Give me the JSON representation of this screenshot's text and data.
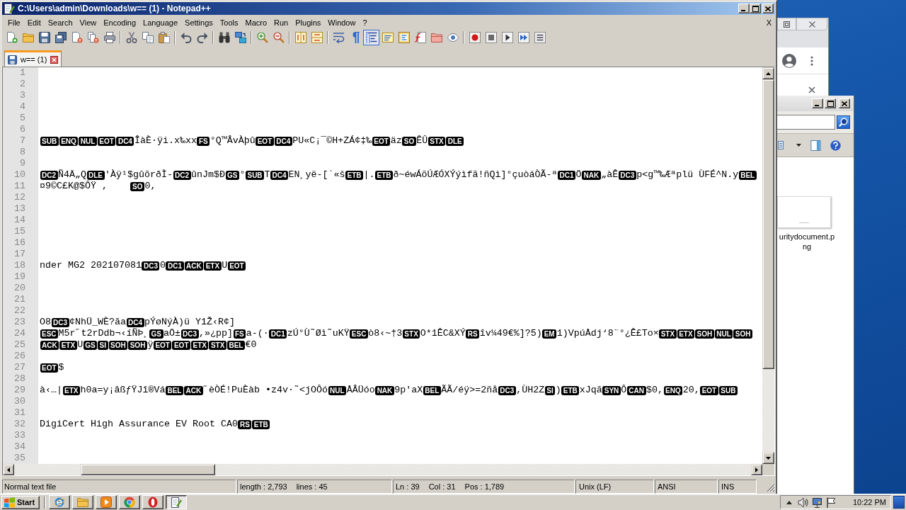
{
  "window": {
    "title": "C:\\Users\\admin\\Downloads\\w== (1) - Notepad++"
  },
  "menu": {
    "items": [
      "File",
      "Edit",
      "Search",
      "View",
      "Encoding",
      "Language",
      "Settings",
      "Tools",
      "Macro",
      "Run",
      "Plugins",
      "Window",
      "?"
    ],
    "close": "X"
  },
  "toolbar": [
    [
      {
        "pressed": false
      },
      {
        "pressed": false
      },
      {
        "pressed": false
      },
      {
        "pressed": false
      },
      {
        "pressed": false
      },
      {
        "pressed": false
      },
      {
        "pressed": false
      }
    ],
    [
      {
        "pressed": false
      },
      {
        "pressed": false
      },
      {
        "pressed": false
      }
    ],
    [
      {
        "pressed": false
      },
      {
        "pressed": false
      }
    ],
    [
      {
        "pressed": false
      },
      {
        "pressed": false
      }
    ],
    [
      {
        "pressed": false
      },
      {
        "pressed": false
      }
    ],
    [
      {
        "pressed": false
      },
      {
        "pressed": false
      }
    ],
    [
      {
        "pressed": false
      },
      {
        "pressed": false
      },
      {
        "pressed": true
      },
      {
        "pressed": false
      },
      {
        "pressed": false
      },
      {
        "pressed": false
      },
      {
        "pressed": false
      },
      {
        "pressed": false
      }
    ],
    [
      {
        "pressed": false
      },
      {
        "pressed": false
      },
      {
        "pressed": false
      },
      {
        "pressed": false
      },
      {
        "pressed": false
      }
    ]
  ],
  "tabs": [
    {
      "label": "w== (1)",
      "selected": true
    }
  ],
  "editor": {
    "lines": [
      {
        "number": "1"
      },
      {
        "number": "2"
      },
      {
        "number": "3"
      },
      {
        "number": "4"
      },
      {
        "number": "5"
      },
      {
        "number": "6"
      },
      {
        "number": "7",
        "segments": [
          {
            "kind": "ctrl",
            "text": "SUB"
          },
          {
            "kind": "ctrl",
            "text": "ENQ"
          },
          {
            "kind": "ctrl",
            "text": "NUL"
          },
          {
            "kind": "ctrl",
            "text": "EOT"
          },
          {
            "kind": "ctrl",
            "text": "DC4"
          },
          {
            "kind": "text",
            "text": "ÎàÈ·ÿi.x‰xx"
          },
          {
            "kind": "ctrl",
            "text": "FS"
          },
          {
            "kind": "text",
            "text": "°Q™ÂvÀþû"
          },
          {
            "kind": "ctrl",
            "text": "EOT"
          },
          {
            "kind": "ctrl",
            "text": "DC4"
          },
          {
            "kind": "text",
            "text": "PU«C¡¯©H+ZÁ¢‡‰"
          },
          {
            "kind": "ctrl",
            "text": "EOT"
          },
          {
            "kind": "text",
            "text": "äz"
          },
          {
            "kind": "ctrl",
            "text": "SO"
          },
          {
            "kind": "text",
            "text": "ÊÛ"
          },
          {
            "kind": "ctrl",
            "text": "STX"
          },
          {
            "kind": "ctrl",
            "text": "DLE"
          }
        ]
      },
      {
        "number": "8"
      },
      {
        "number": "9"
      },
      {
        "number": "10",
        "segments": [
          {
            "kind": "ctrl",
            "text": "DC2"
          },
          {
            "kind": "text",
            "text": "Ñ4Ä„Q"
          },
          {
            "kind": "ctrl",
            "text": "DLE"
          },
          {
            "kind": "text",
            "text": "'Àÿ¹$gûõrðÌ-"
          },
          {
            "kind": "ctrl",
            "text": "DC2"
          },
          {
            "kind": "text",
            "text": "ûnJm$Ð"
          },
          {
            "kind": "ctrl",
            "text": "GS"
          },
          {
            "kind": "text",
            "text": "°"
          },
          {
            "kind": "ctrl",
            "text": "SUB"
          },
          {
            "kind": "text",
            "text": "T"
          },
          {
            "kind": "ctrl",
            "text": "DC4"
          },
          {
            "kind": "text",
            "text": "EN¸yë-[`«š"
          },
          {
            "kind": "ctrl",
            "text": "ETB"
          },
          {
            "kind": "text",
            "text": "|."
          },
          {
            "kind": "ctrl",
            "text": "ETB"
          },
          {
            "kind": "text",
            "text": "ð~éwÁõÚÆÓXÝýìfã!ñQì]°çuòáÒÃ-ª"
          },
          {
            "kind": "ctrl",
            "text": "DC1"
          },
          {
            "kind": "text",
            "text": "Ö"
          },
          {
            "kind": "ctrl",
            "text": "NAK"
          },
          {
            "kind": "text",
            "text": "„àÊ"
          },
          {
            "kind": "ctrl",
            "text": "DC3"
          },
          {
            "kind": "text",
            "text": "p<g™‰Æªplü ÙFÉ^N.y"
          },
          {
            "kind": "ctrl",
            "text": "BEL"
          }
        ]
      },
      {
        "number": "11",
        "segments": [
          {
            "kind": "text",
            "text": "¤9©C£K@$ÔŸ ,    "
          },
          {
            "kind": "ctrl",
            "text": "SO"
          },
          {
            "kind": "text",
            "text": "0,"
          }
        ]
      },
      {
        "number": "12"
      },
      {
        "number": "13"
      },
      {
        "number": "14"
      },
      {
        "number": "15"
      },
      {
        "number": "16"
      },
      {
        "number": "17"
      },
      {
        "number": "18",
        "segments": [
          {
            "kind": "text",
            "text": "nder MG2 202107081"
          },
          {
            "kind": "ctrl",
            "text": "DC3"
          },
          {
            "kind": "text",
            "text": "0"
          },
          {
            "kind": "ctrl",
            "text": "DC1"
          },
          {
            "kind": "ctrl",
            "text": "ACK"
          },
          {
            "kind": "ctrl",
            "text": "ETX"
          },
          {
            "kind": "text",
            "text": "U"
          },
          {
            "kind": "ctrl",
            "text": "EOT"
          }
        ]
      },
      {
        "number": "19"
      },
      {
        "number": "20"
      },
      {
        "number": "21"
      },
      {
        "number": "22"
      },
      {
        "number": "23",
        "segments": [
          {
            "kind": "text",
            "text": "O8"
          },
          {
            "kind": "ctrl",
            "text": "DC3"
          },
          {
            "kind": "text",
            "text": "¢NhÜ_WÈ?ãa"
          },
          {
            "kind": "ctrl",
            "text": "DC4"
          },
          {
            "kind": "text",
            "text": "pÝøNýÀ)ü Y1Ž‹R¢]"
          }
        ]
      },
      {
        "number": "24",
        "segments": [
          {
            "kind": "ctrl",
            "text": "ESC"
          },
          {
            "kind": "text",
            "text": "M5r˝t2rDdb¬‹íÑÞ¸"
          },
          {
            "kind": "ctrl",
            "text": "GS"
          },
          {
            "kind": "text",
            "text": "aÖ±"
          },
          {
            "kind": "ctrl",
            "text": "DC3"
          },
          {
            "kind": "text",
            "text": ",»¿pp]"
          },
          {
            "kind": "ctrl",
            "text": "FS"
          },
          {
            "kind": "text",
            "text": "a-(·"
          },
          {
            "kind": "ctrl",
            "text": "DC1"
          },
          {
            "kind": "text",
            "text": "zÚ°Ù˜Øì˜uKŸ"
          },
          {
            "kind": "ctrl",
            "text": "ESC"
          },
          {
            "kind": "text",
            "text": "ò8‹~†3"
          },
          {
            "kind": "ctrl",
            "text": "STX"
          },
          {
            "kind": "text",
            "text": "O*1ÊC&XÝ"
          },
          {
            "kind": "ctrl",
            "text": "RS"
          },
          {
            "kind": "text",
            "text": "îv¼49€%]?5)"
          },
          {
            "kind": "ctrl",
            "text": "EM"
          },
          {
            "kind": "text",
            "text": "1)VpúÅdj‘8¨°¿Ê£To×"
          },
          {
            "kind": "ctrl",
            "text": "STX"
          },
          {
            "kind": "ctrl",
            "text": "ETX"
          },
          {
            "kind": "ctrl",
            "text": "SOH"
          },
          {
            "kind": "ctrl",
            "text": "NUL"
          },
          {
            "kind": "ctrl",
            "text": "SOH"
          }
        ]
      },
      {
        "number": "25",
        "segments": [
          {
            "kind": "ctrl",
            "text": "ACK"
          },
          {
            "kind": "ctrl",
            "text": "ETX"
          },
          {
            "kind": "text",
            "text": "U"
          },
          {
            "kind": "ctrl",
            "text": "GS"
          },
          {
            "kind": "ctrl",
            "text": "SI"
          },
          {
            "kind": "ctrl",
            "text": "SOH"
          },
          {
            "kind": "ctrl",
            "text": "SOH"
          },
          {
            "kind": "text",
            "text": "ÿ"
          },
          {
            "kind": "ctrl",
            "text": "EOT"
          },
          {
            "kind": "ctrl",
            "text": "EOT"
          },
          {
            "kind": "ctrl",
            "text": "ETX"
          },
          {
            "kind": "ctrl",
            "text": "STX"
          },
          {
            "kind": "ctrl",
            "text": "BEL"
          },
          {
            "kind": "text",
            "text": "€0"
          }
        ]
      },
      {
        "number": "26"
      },
      {
        "number": "27",
        "segments": [
          {
            "kind": "ctrl",
            "text": "EOT"
          },
          {
            "kind": "text",
            "text": "$"
          }
        ]
      },
      {
        "number": "28"
      },
      {
        "number": "29",
        "segments": [
          {
            "kind": "text",
            "text": "à‹…|"
          },
          {
            "kind": "ctrl",
            "text": "ETX"
          },
          {
            "kind": "text",
            "text": "h0a=y¡âßƒŸJî®Vá"
          },
          {
            "kind": "ctrl",
            "text": "BEL"
          },
          {
            "kind": "ctrl",
            "text": "ACK"
          },
          {
            "kind": "text",
            "text": "˝èÒÉ!PuÈàb •z4v·˜<jOÔó"
          },
          {
            "kind": "ctrl",
            "text": "NUL"
          },
          {
            "kind": "text",
            "text": "ÅÂÜóo"
          },
          {
            "kind": "ctrl",
            "text": "NAK"
          },
          {
            "kind": "text",
            "text": "9p'aX"
          },
          {
            "kind": "ctrl",
            "text": "BEL"
          },
          {
            "kind": "text",
            "text": "ÃÃ/éÿ>=2ñå"
          },
          {
            "kind": "ctrl",
            "text": "DC3"
          },
          {
            "kind": "text",
            "text": ",ÙH2Z"
          },
          {
            "kind": "ctrl",
            "text": "SI"
          },
          {
            "kind": "text",
            "text": ")"
          },
          {
            "kind": "ctrl",
            "text": "ETB"
          },
          {
            "kind": "text",
            "text": "xJqã"
          },
          {
            "kind": "ctrl",
            "text": "SYN"
          },
          {
            "kind": "text",
            "text": "Ô"
          },
          {
            "kind": "ctrl",
            "text": "CAN"
          },
          {
            "kind": "text",
            "text": "$0,"
          },
          {
            "kind": "ctrl",
            "text": "ENQ"
          },
          {
            "kind": "text",
            "text": "20,"
          },
          {
            "kind": "ctrl",
            "text": "EOT"
          },
          {
            "kind": "ctrl",
            "text": "SUB"
          }
        ]
      },
      {
        "number": "30"
      },
      {
        "number": "31"
      },
      {
        "number": "32",
        "segments": [
          {
            "kind": "text",
            "text": "DigiCert High Assurance EV Root CA0"
          },
          {
            "kind": "ctrl",
            "text": "RS"
          },
          {
            "kind": "ctrl",
            "text": "ETB"
          }
        ]
      },
      {
        "number": "33"
      },
      {
        "number": "34"
      },
      {
        "number": "35"
      }
    ]
  },
  "status_bar": [
    {
      "texts": [
        "Normal text file"
      ]
    },
    {
      "texts": [
        "length : 2,793",
        "lines : 45"
      ]
    },
    {
      "texts": [
        "Ln : 39",
        "Col : 31",
        "Pos : 1,789"
      ]
    },
    {
      "texts": [
        "Unix (LF)"
      ]
    },
    {
      "texts": [
        "ANSI"
      ]
    },
    {
      "texts": [
        "INS"
      ]
    }
  ],
  "explorer": {
    "file_label": "uritydocument.png"
  },
  "taskbar": {
    "start": "Start",
    "buttons": [
      {
        "selected": false
      },
      {
        "selected": false
      },
      {
        "selected": false
      },
      {
        "selected": false
      },
      {
        "selected": false
      },
      {
        "selected": true
      }
    ],
    "clock": "10:22 PM"
  }
}
